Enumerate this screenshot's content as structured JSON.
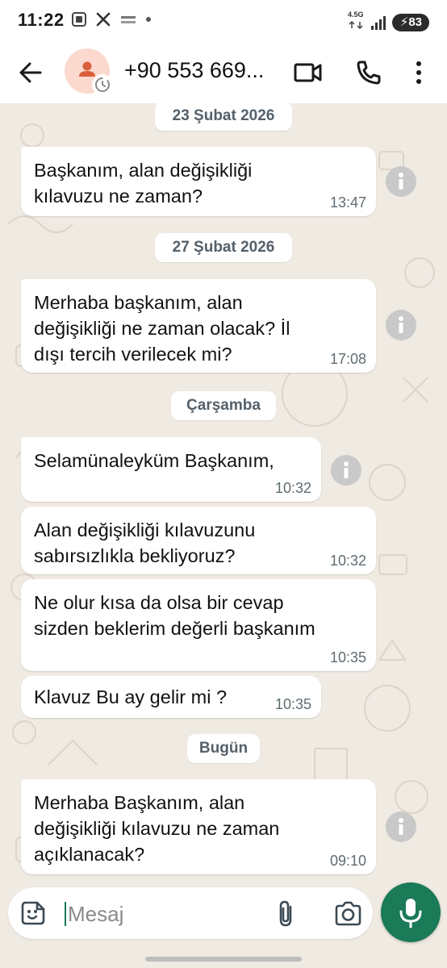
{
  "status_bar": {
    "time": "11:22",
    "network_label": "4.5G",
    "battery": "83"
  },
  "header": {
    "back_icon": "arrow-left-icon",
    "contact_name": "+90 553 669...",
    "icons": [
      "video-call-icon",
      "phone-icon",
      "more-vertical-icon"
    ]
  },
  "date_chips": [
    "23 Şubat 2026",
    "27 Şubat 2026",
    "Çarşamba",
    "Bugün"
  ],
  "messages": [
    {
      "text": "Başkanım, alan değişikliği\nkılavuzu ne zaman?",
      "time": "13:47"
    },
    {
      "text": "Merhaba başkanım, alan\ndeğişikliği ne zaman olacak? İl\ndışı tercih verilecek mi?",
      "time": "17:08"
    },
    {
      "text": "Selamünaleyküm Başkanım,",
      "time": "10:32"
    },
    {
      "text": "Alan değişikliği kılavuzunu\nsabırsızlıkla bekliyoruz?",
      "time": "10:32"
    },
    {
      "text": "Ne olur kısa da olsa bir cevap\nsizden beklerim değerli başkanım",
      "time": "10:35"
    },
    {
      "text": "Klavuz Bu ay gelir mi ?",
      "time": "10:35"
    },
    {
      "text": "Merhaba Başkanım, alan\ndeğişikliği kılavuzu ne zaman\naçıklanacak?",
      "time": "09:10"
    }
  ],
  "composer": {
    "placeholder": "Mesaj",
    "icons": [
      "emoji-sticker-icon",
      "paperclip-icon",
      "camera-icon",
      "microphone-icon"
    ]
  },
  "colors": {
    "chat_background": "#efeae2",
    "bubble": "#ffffff",
    "accent_green": "#1b7a57",
    "avatar_bg": "#fbd9cf",
    "avatar_fg": "#d9603b"
  }
}
